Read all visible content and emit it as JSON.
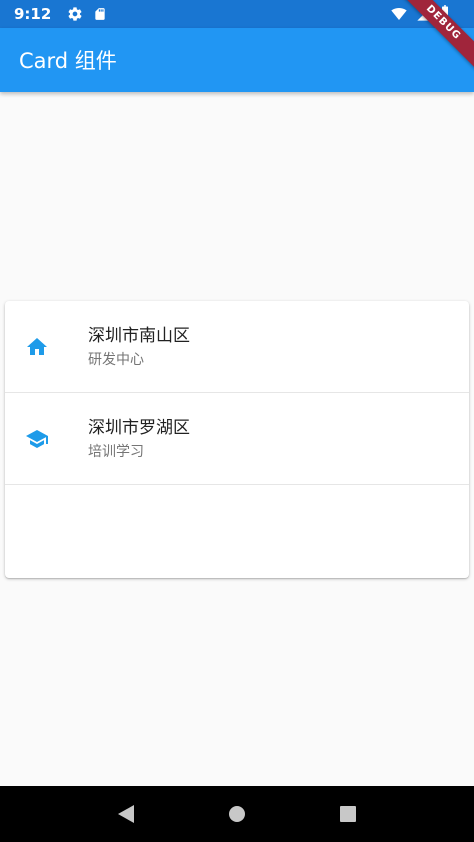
{
  "status_bar": {
    "time": "9:12",
    "icons": [
      "gear-icon",
      "sd-card-icon",
      "wifi-icon",
      "signal-icon",
      "battery-icon"
    ]
  },
  "debug_banner": "DEBUG",
  "app_bar": {
    "title": "Card 组件",
    "color": "#2196f3"
  },
  "card": {
    "items": [
      {
        "icon": "home-icon",
        "title": "深圳市南山区",
        "subtitle": "研发中心"
      },
      {
        "icon": "school-icon",
        "title": "深圳市罗湖区",
        "subtitle": "培训学习"
      }
    ],
    "icon_color": "#1e9be9"
  },
  "nav_bar": {
    "buttons": [
      "back-icon",
      "home-circle-icon",
      "recents-icon"
    ]
  }
}
